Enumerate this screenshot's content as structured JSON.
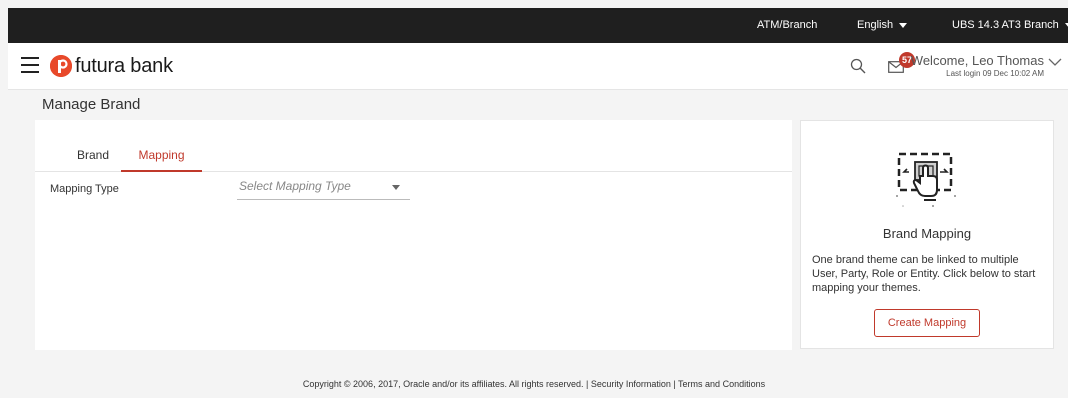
{
  "topbar": {
    "atm_branch": "ATM/Branch",
    "language": "English",
    "branch": "UBS 14.3 AT3 Branch"
  },
  "header": {
    "logo_text": "futura bank",
    "notification_count": "57",
    "welcome": "Welcome, Leo Thomas",
    "last_login": "Last login 09 Dec 10:02 AM"
  },
  "page": {
    "title": "Manage Brand"
  },
  "tabs": [
    {
      "label": "Brand",
      "active": false
    },
    {
      "label": "Mapping",
      "active": true
    }
  ],
  "form": {
    "mapping_type_label": "Mapping Type",
    "mapping_type_placeholder": "Select Mapping Type"
  },
  "side_panel": {
    "title": "Brand Mapping",
    "description": "One brand theme can be linked to multiple User, Party, Role or Entity. Click below to start mapping your themes.",
    "button": "Create Mapping"
  },
  "footer": {
    "text": "Copyright © 2006, 2017, Oracle and/or its affiliates. All rights reserved. | Security Information | Terms and Conditions"
  },
  "colors": {
    "accent": "#c0392b",
    "topbar_bg": "#1f1f1f",
    "logo": "#e8492a"
  },
  "icons": [
    "hamburger-menu-icon",
    "search-icon",
    "mail-icon",
    "chevron-down-icon",
    "brand-mapping-illustration"
  ]
}
